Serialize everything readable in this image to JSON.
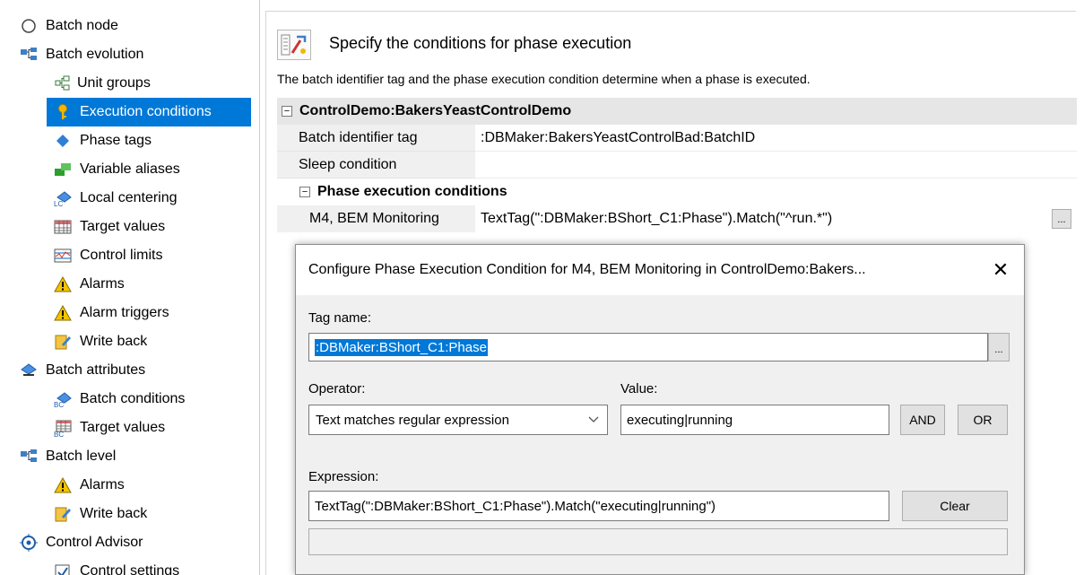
{
  "tree": {
    "items": [
      {
        "label": "Batch node",
        "icon": "circle-icon"
      },
      {
        "label": "Batch evolution",
        "icon": "hierarchy-icon"
      },
      {
        "label": "Unit groups",
        "icon": "unit-groups-icon"
      },
      {
        "label": "Execution conditions",
        "icon": "key-icon"
      },
      {
        "label": "Phase tags",
        "icon": "diamond-icon"
      },
      {
        "label": "Variable aliases",
        "icon": "alias-icon"
      },
      {
        "label": "Local centering",
        "icon": "local-centering-icon"
      },
      {
        "label": "Target values",
        "icon": "grid-icon"
      },
      {
        "label": "Control limits",
        "icon": "control-limits-icon"
      },
      {
        "label": "Alarms",
        "icon": "warning-icon"
      },
      {
        "label": "Alarm triggers",
        "icon": "warning-icon"
      },
      {
        "label": "Write back",
        "icon": "write-back-icon"
      },
      {
        "label": "Batch attributes",
        "icon": "batch-attributes-icon"
      },
      {
        "label": "Batch conditions",
        "icon": "batch-conditions-icon"
      },
      {
        "label": "Target values",
        "icon": "batch-target-values-icon"
      },
      {
        "label": "Batch level",
        "icon": "hierarchy-icon"
      },
      {
        "label": "Alarms",
        "icon": "warning-icon"
      },
      {
        "label": "Write back",
        "icon": "write-back-icon"
      },
      {
        "label": "Control Advisor",
        "icon": "target-icon"
      },
      {
        "label": "Control settings",
        "icon": "checkbox-icon"
      }
    ],
    "selected_index": 3
  },
  "header": {
    "title": "Specify the conditions for phase execution",
    "description": "The batch identifier tag and the phase execution condition determine when a phase is executed."
  },
  "grid": {
    "category": "ControlDemo:BakersYeastControlDemo",
    "rows": [
      {
        "name": "Batch identifier tag",
        "value": ":DBMaker:BakersYeastControlBad:BatchID"
      },
      {
        "name": "Sleep condition",
        "value": ""
      }
    ],
    "subcategory": "Phase execution conditions",
    "phase_row": {
      "name": "M4, BEM Monitoring",
      "value": "TextTag(\":DBMaker:BShort_C1:Phase\").Match(\"^run.*\")",
      "button": "..."
    }
  },
  "dialog": {
    "title": "Configure Phase Execution Condition for M4, BEM Monitoring in ControlDemo:Bakers...",
    "close": "✕",
    "tag_name_label": "Tag name:",
    "tag_name_value": ":DBMaker:BShort_C1:Phase",
    "tag_browse": "...",
    "operator_label": "Operator:",
    "operator_value": "Text matches regular expression",
    "value_label": "Value:",
    "value_value": "executing|running",
    "and_button": "AND",
    "or_button": "OR",
    "expression_label": "Expression:",
    "expression_value": "TextTag(\":DBMaker:BShort_C1:Phase\").Match(\"executing|running\")",
    "clear_button": "Clear",
    "status_value": ""
  }
}
